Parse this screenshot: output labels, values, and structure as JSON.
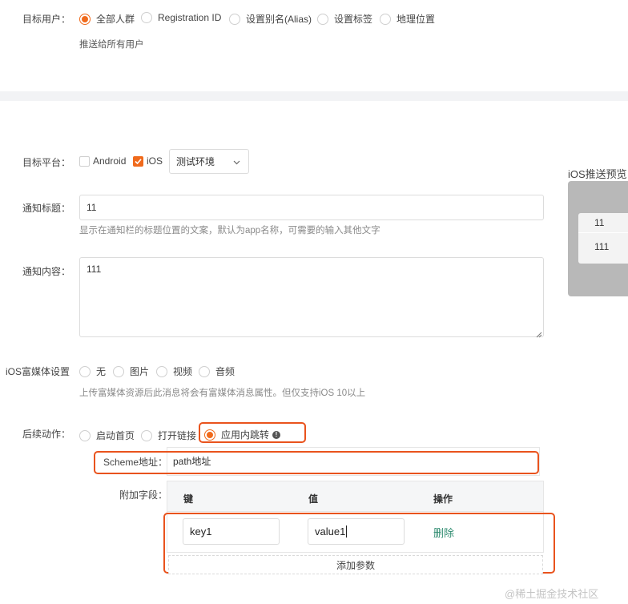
{
  "target_users": {
    "label": "目标用户：",
    "options": [
      "全部人群",
      "Registration ID",
      "设置别名(Alias)",
      "设置标签",
      "地理位置"
    ],
    "selected_index": 0,
    "hint": "推送给所有用户"
  },
  "platform": {
    "label": "目标平台：",
    "android_label": "Android",
    "android_checked": false,
    "ios_label": "iOS",
    "ios_checked": true,
    "env_value": "测试环境"
  },
  "notification_title": {
    "label": "通知标题：",
    "value": "11",
    "hint": "显示在通知栏的标题位置的文案，默认为app名称，可需要的输入其他文字"
  },
  "notification_content": {
    "label": "通知内容：",
    "value": "111"
  },
  "rich_media": {
    "label": "iOS富媒体设置",
    "options": [
      "无",
      "图片",
      "视频",
      "音频"
    ],
    "selected_index": -1,
    "hint": "上传富媒体资源后此消息将会有富媒体消息属性。但仅支持iOS 10以上"
  },
  "follow_action": {
    "label": "后续动作：",
    "options": [
      "启动首页",
      "打开链接",
      "应用内跳转"
    ],
    "selected_index": 2,
    "info_icon": "info-icon"
  },
  "scheme": {
    "label": "Scheme地址：",
    "value": "path地址"
  },
  "extra_fields": {
    "label": "附加字段：",
    "columns": [
      "键",
      "值",
      "操作"
    ],
    "rows": [
      {
        "key": "key1",
        "value": "value1",
        "action": "删除"
      }
    ],
    "add_label": "添加参数"
  },
  "preview": {
    "title": "iOS推送预览",
    "notif_title": "11",
    "notif_body": "111"
  },
  "watermark": "@稀土掘金技术社区",
  "colors": {
    "accent": "#f06a1c",
    "highlight_border": "#e9531d",
    "delete_link": "#2e8b6f"
  }
}
